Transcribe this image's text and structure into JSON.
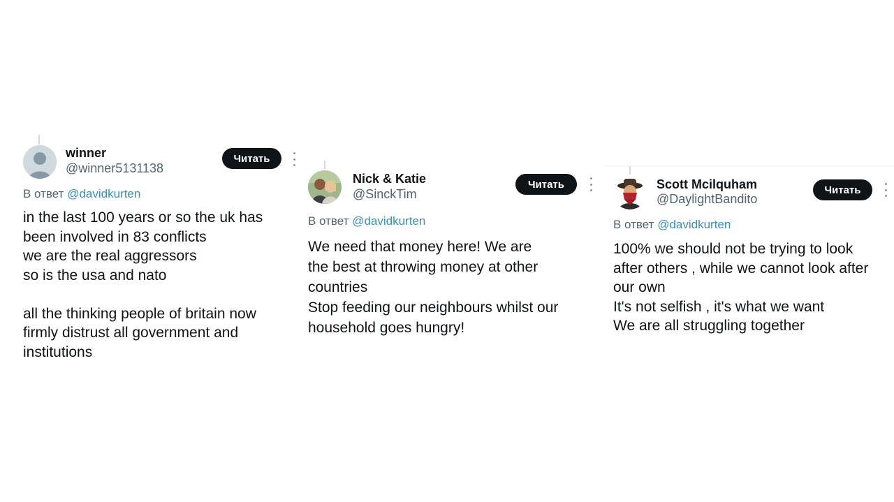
{
  "button_label": "Читать",
  "reply_prefix": "В ответ",
  "accent_color": "#1d9bf0",
  "tweets": [
    {
      "name": "winner",
      "handle": "@winner5131138",
      "reply_to": "@davidkurten",
      "lines": [
        "in the last 100 years or so the uk has",
        "been involved in 83 conflicts",
        "we are the real aggressors",
        "so is the usa and nato",
        "",
        "all the thinking people of britain now",
        "firmly distrust all government and",
        "institutions"
      ]
    },
    {
      "name": "Nick & Katie",
      "handle": "@SinckTim",
      "reply_to": "@davidkurten",
      "lines": [
        "We need that money here! We are",
        "the best at throwing money at other",
        "countries",
        "Stop feeding our neighbours whilst our",
        "household goes hungry!"
      ]
    },
    {
      "name": "Scott Mcilquham",
      "handle": "@DaylightBandito",
      "reply_to": "@davidkurten",
      "lines": [
        "100% we should not be trying to look",
        "after others , while we cannot look after",
        "our own",
        "It's not selfish , it's what we want",
        "We are all struggling together"
      ]
    }
  ]
}
